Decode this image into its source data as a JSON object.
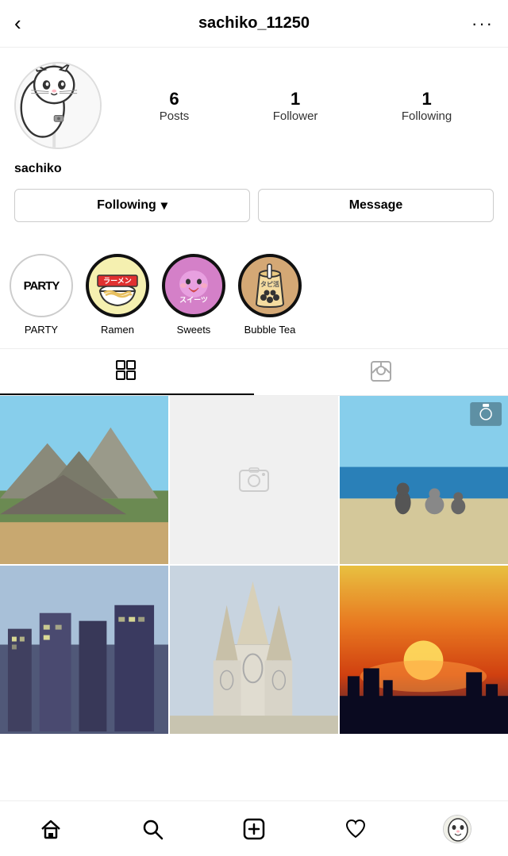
{
  "header": {
    "back_label": "‹",
    "username": "sachiko_11250",
    "more_label": "···"
  },
  "profile": {
    "display_name": "sachiko",
    "stats": {
      "posts_count": "6",
      "posts_label": "Posts",
      "followers_count": "1",
      "followers_label": "Follower",
      "following_count": "1",
      "following_label": "Following"
    }
  },
  "buttons": {
    "following_label": "Following",
    "following_chevron": "▾",
    "message_label": "Message"
  },
  "highlights": [
    {
      "id": "party",
      "label": "PARTY",
      "text": "PARTY",
      "type": "party"
    },
    {
      "id": "ramen",
      "label": "Ramen",
      "text": "ラーメン",
      "type": "ramen"
    },
    {
      "id": "sweets",
      "label": "Sweets",
      "text": "スイーツ",
      "type": "sweets"
    },
    {
      "id": "bubble",
      "label": "Bubble Tea",
      "text": "タピ活",
      "type": "bubble"
    }
  ],
  "tabs": {
    "grid_label": "grid",
    "tagged_label": "tagged"
  },
  "grid": {
    "cells": [
      {
        "id": "cell-1",
        "type": "mountain"
      },
      {
        "id": "cell-2",
        "type": "placeholder"
      },
      {
        "id": "cell-3",
        "type": "beach"
      },
      {
        "id": "cell-4",
        "type": "city"
      },
      {
        "id": "cell-5",
        "type": "cathedral"
      },
      {
        "id": "cell-6",
        "type": "sunset"
      }
    ]
  },
  "nav": {
    "home_label": "home",
    "search_label": "search",
    "add_label": "add",
    "heart_label": "heart",
    "profile_label": "profile"
  }
}
